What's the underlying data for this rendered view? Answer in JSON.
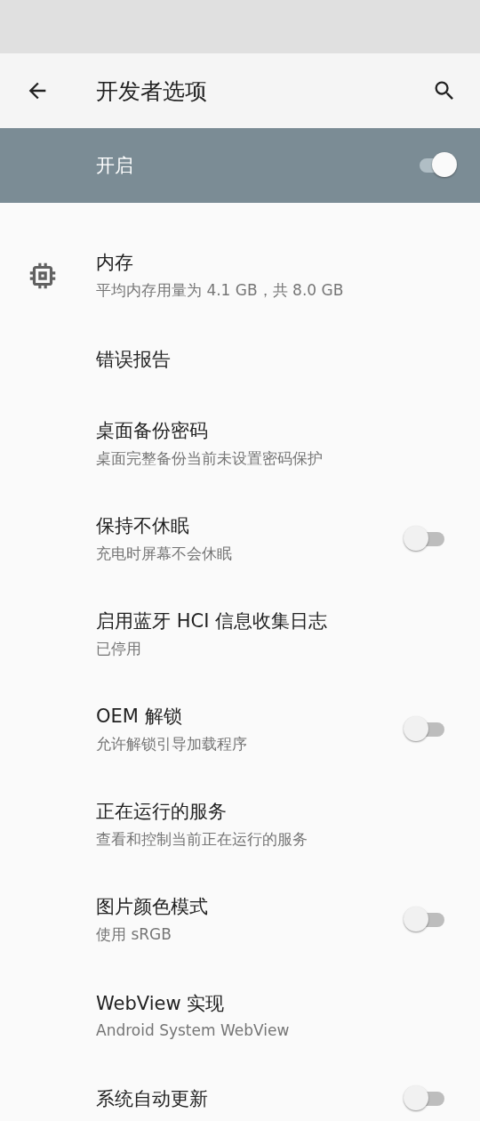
{
  "toolbar": {
    "title": "开发者选项"
  },
  "master_switch": {
    "label": "开启",
    "on": true
  },
  "settings": [
    {
      "kind": "icon",
      "title": "内存",
      "summary": "平均内存用量为 4.1 GB，共 8.0 GB"
    },
    {
      "kind": "plain",
      "title": "错误报告"
    },
    {
      "kind": "plain",
      "title": "桌面备份密码",
      "summary": "桌面完整备份当前未设置密码保护"
    },
    {
      "kind": "switch",
      "title": "保持不休眠",
      "summary": "充电时屏幕不会休眠",
      "on": false
    },
    {
      "kind": "plain",
      "title": "启用蓝牙 HCI 信息收集日志",
      "summary": "已停用"
    },
    {
      "kind": "switch",
      "title": "OEM 解锁",
      "summary": "允许解锁引导加载程序",
      "on": false
    },
    {
      "kind": "plain",
      "title": "正在运行的服务",
      "summary": "查看和控制当前正在运行的服务"
    },
    {
      "kind": "switch",
      "title": "图片颜色模式",
      "summary": "使用 sRGB",
      "on": false
    },
    {
      "kind": "plain",
      "title": "WebView 实现",
      "summary": "Android System WebView"
    },
    {
      "kind": "switch",
      "title": "系统自动更新",
      "on": false
    }
  ]
}
